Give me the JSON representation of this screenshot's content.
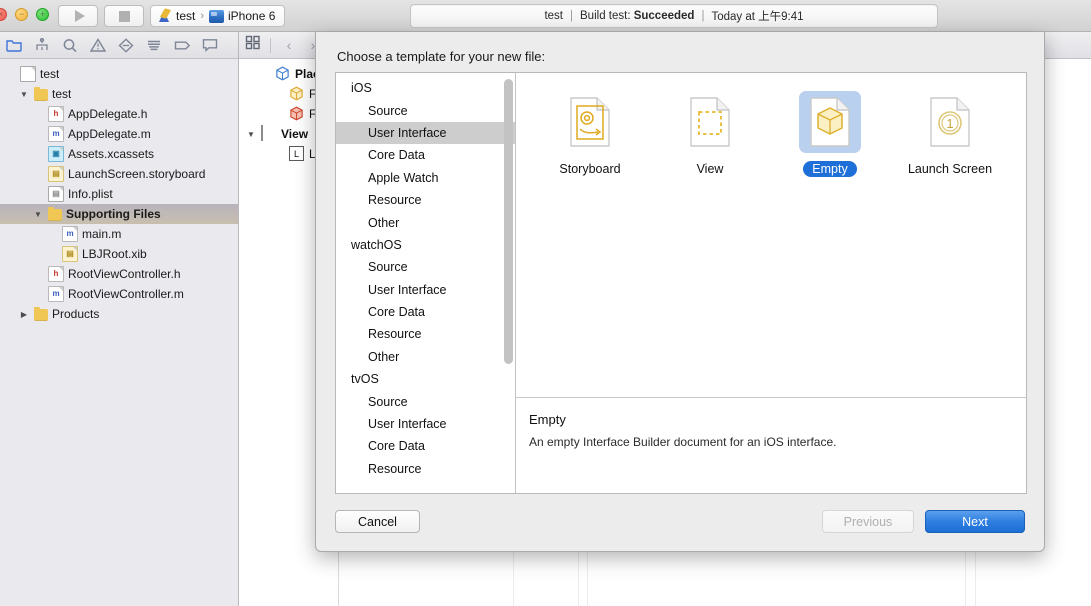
{
  "window": {
    "traffic_lights": [
      {
        "name": "close",
        "glyph": "×"
      },
      {
        "name": "minimize",
        "glyph": "−"
      },
      {
        "name": "maximize",
        "glyph": "+"
      }
    ],
    "run_button": "Run",
    "stop_button": "Stop",
    "scheme": {
      "scheme_name": "test",
      "separator": "›",
      "destination": "iPhone 6"
    },
    "status": {
      "project": "test",
      "sep1": "|",
      "build": "Build test:",
      "result": "Succeeded",
      "sep2": "|",
      "time": "Today at 上午9:41"
    }
  },
  "navigator": {
    "toolbar_icons": [
      {
        "name": "project-navigator-icon",
        "selected": true
      },
      {
        "name": "source-control-navigator-icon",
        "selected": false
      },
      {
        "name": "symbol-navigator-icon",
        "selected": false
      },
      {
        "name": "issue-navigator-icon",
        "selected": false
      },
      {
        "name": "test-navigator-icon",
        "selected": false
      },
      {
        "name": "debug-navigator-icon",
        "selected": false
      },
      {
        "name": "breakpoint-navigator-icon",
        "selected": false
      },
      {
        "name": "report-navigator-icon",
        "selected": false
      }
    ],
    "files": [
      {
        "label": "test",
        "icon": "project",
        "indent": 0,
        "twisty": "",
        "selected": false
      },
      {
        "label": "test",
        "icon": "folder",
        "indent": 1,
        "twisty": "▼",
        "selected": false
      },
      {
        "label": "AppDelegate.h",
        "icon": "h",
        "indent": 2,
        "twisty": "",
        "selected": false
      },
      {
        "label": "AppDelegate.m",
        "icon": "m",
        "indent": 2,
        "twisty": "",
        "selected": false
      },
      {
        "label": "Assets.xcassets",
        "icon": "xca",
        "indent": 2,
        "twisty": "",
        "selected": false
      },
      {
        "label": "LaunchScreen.storyboard",
        "icon": "sb",
        "indent": 2,
        "twisty": "",
        "selected": false
      },
      {
        "label": "Info.plist",
        "icon": "plist",
        "indent": 2,
        "twisty": "",
        "selected": false
      },
      {
        "label": "Supporting Files",
        "icon": "folder",
        "indent": 2,
        "twisty": "▼",
        "selected": true
      },
      {
        "label": "main.m",
        "icon": "m",
        "indent": 3,
        "twisty": "",
        "selected": false
      },
      {
        "label": "LBJRoot.xib",
        "icon": "xib",
        "indent": 3,
        "twisty": "",
        "selected": false
      },
      {
        "label": "RootViewController.h",
        "icon": "h",
        "indent": 2,
        "twisty": "",
        "selected": false
      },
      {
        "label": "RootViewController.m",
        "icon": "m",
        "indent": 2,
        "twisty": "",
        "selected": false
      },
      {
        "label": "Products",
        "icon": "folder",
        "indent": 1,
        "twisty": "▶",
        "selected": false
      }
    ]
  },
  "editor": {
    "toolbar": {
      "view_mode_icon": "grid-view-icon",
      "back_arrow": "‹",
      "forward_arrow": "›"
    },
    "outline": [
      {
        "label": "Placeh",
        "icon": "placeholder-cube",
        "indent": 1,
        "twisty": "",
        "bold": true
      },
      {
        "label": "File",
        "icon": "file-owner-cube",
        "indent": 2,
        "twisty": "",
        "bold": false
      },
      {
        "label": "Firs",
        "icon": "first-responder-cube",
        "indent": 2,
        "twisty": "",
        "bold": false
      },
      {
        "label": "View",
        "icon": "view-square",
        "indent": 0,
        "twisty": "▼",
        "bold": true
      },
      {
        "label": "Lab",
        "icon": "label-box",
        "indent": 2,
        "twisty": "",
        "bold": false
      }
    ]
  },
  "dialog": {
    "title": "Choose a template for your new file:",
    "categories": [
      {
        "label": "iOS",
        "type": "group",
        "selected": false
      },
      {
        "label": "Source",
        "type": "child",
        "selected": false
      },
      {
        "label": "User Interface",
        "type": "child",
        "selected": true
      },
      {
        "label": "Core Data",
        "type": "child",
        "selected": false
      },
      {
        "label": "Apple Watch",
        "type": "child",
        "selected": false
      },
      {
        "label": "Resource",
        "type": "child",
        "selected": false
      },
      {
        "label": "Other",
        "type": "child",
        "selected": false
      },
      {
        "label": "watchOS",
        "type": "group",
        "selected": false
      },
      {
        "label": "Source",
        "type": "child",
        "selected": false
      },
      {
        "label": "User Interface",
        "type": "child",
        "selected": false
      },
      {
        "label": "Core Data",
        "type": "child",
        "selected": false
      },
      {
        "label": "Resource",
        "type": "child",
        "selected": false
      },
      {
        "label": "Other",
        "type": "child",
        "selected": false
      },
      {
        "label": "tvOS",
        "type": "group",
        "selected": false
      },
      {
        "label": "Source",
        "type": "child",
        "selected": false
      },
      {
        "label": "User Interface",
        "type": "child",
        "selected": false
      },
      {
        "label": "Core Data",
        "type": "child",
        "selected": false
      },
      {
        "label": "Resource",
        "type": "child",
        "selected": false
      }
    ],
    "templates": [
      {
        "label": "Storyboard",
        "icon": "storyboard-doc-icon",
        "selected": false
      },
      {
        "label": "View",
        "icon": "view-doc-icon",
        "selected": false
      },
      {
        "label": "Empty",
        "icon": "empty-doc-icon",
        "selected": true
      },
      {
        "label": "Launch Screen",
        "icon": "launch-screen-doc-icon",
        "selected": false
      }
    ],
    "description": {
      "title": "Empty",
      "body": "An empty Interface Builder document for an iOS interface."
    },
    "buttons": {
      "cancel": "Cancel",
      "previous": "Previous",
      "next": "Next"
    },
    "accent_color": "#1f6fd8"
  }
}
